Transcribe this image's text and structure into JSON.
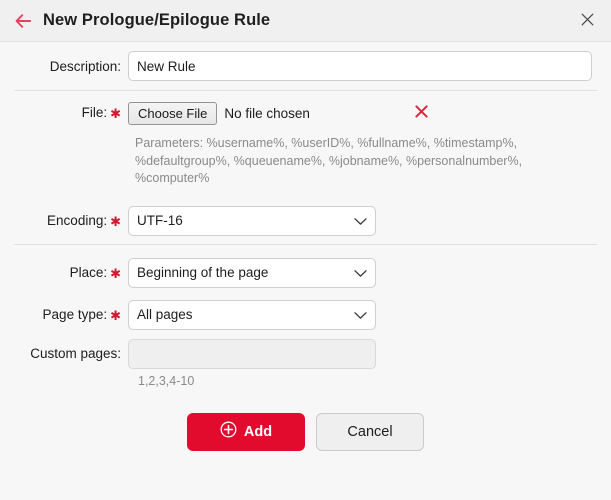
{
  "header": {
    "title": "New Prologue/Epilogue Rule",
    "back_icon": "arrow-left-icon",
    "close_icon": "close-icon",
    "accent_color": "#e30b2d"
  },
  "form": {
    "description": {
      "label": "Description:",
      "value": "New Rule",
      "required": false
    },
    "file": {
      "label": "File:",
      "required": true,
      "required_marker": "✱",
      "button_label": "Choose File",
      "status_text": "No file chosen",
      "delete_icon": "close-icon",
      "delete_color": "#e2223e",
      "hint": "Parameters: %username%, %userID%, %fullname%, %timestamp%, %defaultgroup%, %queuename%, %jobname%, %personalnumber%, %computer%"
    },
    "encoding": {
      "label": "Encoding:",
      "required": true,
      "required_marker": "✱",
      "value": "UTF-16"
    },
    "place": {
      "label": "Place:",
      "required": true,
      "required_marker": "✱",
      "value": "Beginning of the page"
    },
    "page_type": {
      "label": "Page type:",
      "required": true,
      "required_marker": "✱",
      "value": "All pages"
    },
    "custom_pages": {
      "label": "Custom pages:",
      "required": false,
      "value": "",
      "placeholder": "",
      "hint": "1,2,3,4-10"
    }
  },
  "footer": {
    "add_label": "Add",
    "add_icon": "plus-circle-icon",
    "cancel_label": "Cancel"
  }
}
